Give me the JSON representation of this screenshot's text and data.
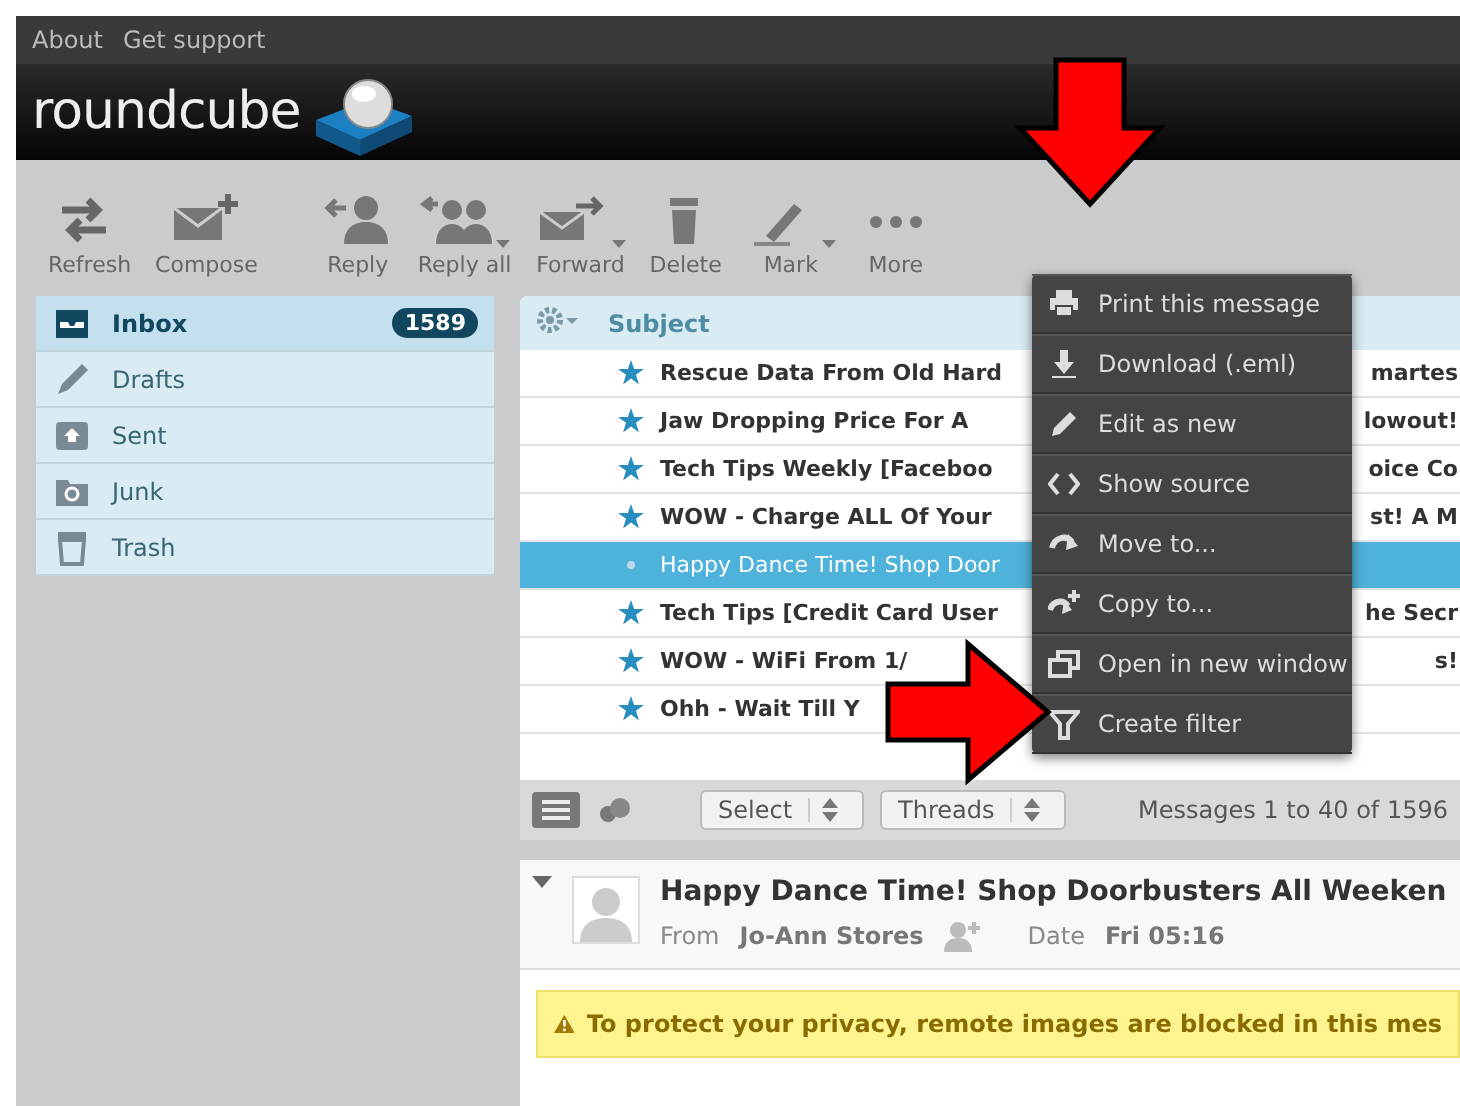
{
  "top_links": [
    "About",
    "Get support"
  ],
  "logo": {
    "text": "roundcube"
  },
  "toolbar": [
    {
      "label": "Refresh",
      "kind": "refresh",
      "dropdown": false
    },
    {
      "label": "Compose",
      "kind": "compose",
      "dropdown": false
    },
    {
      "label": "Reply",
      "kind": "reply",
      "dropdown": false
    },
    {
      "label": "Reply all",
      "kind": "replyall",
      "dropdown": true
    },
    {
      "label": "Forward",
      "kind": "forward",
      "dropdown": true
    },
    {
      "label": "Delete",
      "kind": "delete",
      "dropdown": false
    },
    {
      "label": "Mark",
      "kind": "mark",
      "dropdown": true
    },
    {
      "label": "More",
      "kind": "more",
      "dropdown": false
    }
  ],
  "folders": [
    {
      "name": "Inbox",
      "kind": "inbox",
      "selected": true,
      "unread": "1589"
    },
    {
      "name": "Drafts",
      "kind": "drafts",
      "selected": false
    },
    {
      "name": "Sent",
      "kind": "sent",
      "selected": false
    },
    {
      "name": "Junk",
      "kind": "junk",
      "selected": false
    },
    {
      "name": "Trash",
      "kind": "trash",
      "selected": false
    }
  ],
  "list": {
    "column": "Subject",
    "rows": [
      {
        "subject": "Rescue Data From Old Hard",
        "tail": "martes",
        "starred": true,
        "unread": true,
        "selected": false
      },
      {
        "subject": "Jaw Dropping Price For A",
        "tail": "lowout!",
        "starred": true,
        "unread": true,
        "selected": false
      },
      {
        "subject": "Tech Tips Weekly [Faceboo",
        "tail": "oice Co",
        "starred": true,
        "unread": true,
        "selected": false
      },
      {
        "subject": "WOW - Charge ALL Of Your",
        "tail": "st! A M",
        "starred": true,
        "unread": true,
        "selected": false
      },
      {
        "subject": "Happy Dance Time! Shop Door",
        "starred": false,
        "unread": false,
        "selected": true
      },
      {
        "subject": "Tech Tips [Credit Card User",
        "tail": "he Secr",
        "starred": true,
        "unread": true,
        "selected": false
      },
      {
        "subject": "WOW - WiFi From 1/",
        "tail": "s!",
        "starred": true,
        "unread": true,
        "selected": false
      },
      {
        "subject": "Ohh - Wait Till Y",
        "starred": true,
        "unread": true,
        "selected": false
      }
    ],
    "footer": {
      "select": "Select",
      "threads": "Threads",
      "count": "Messages 1 to 40 of 1596"
    }
  },
  "preview": {
    "subject": "Happy Dance Time! Shop Doorbusters All Weeken",
    "from_label": "From",
    "from": "Jo-Ann Stores",
    "date_label": "Date",
    "date": "Fri 05:16",
    "notice": "To protect your privacy, remote images are blocked in this mes"
  },
  "menu": {
    "items": [
      {
        "label": "Print this message",
        "kind": "print"
      },
      {
        "label": "Download (.eml)",
        "kind": "download"
      },
      {
        "label": "Edit as new",
        "kind": "edit"
      },
      {
        "label": "Show source",
        "kind": "source"
      },
      {
        "label": "Move to...",
        "kind": "move"
      },
      {
        "label": "Copy to...",
        "kind": "copy"
      },
      {
        "label": "Open in new window",
        "kind": "window"
      },
      {
        "label": "Create filter",
        "kind": "filter"
      }
    ]
  }
}
